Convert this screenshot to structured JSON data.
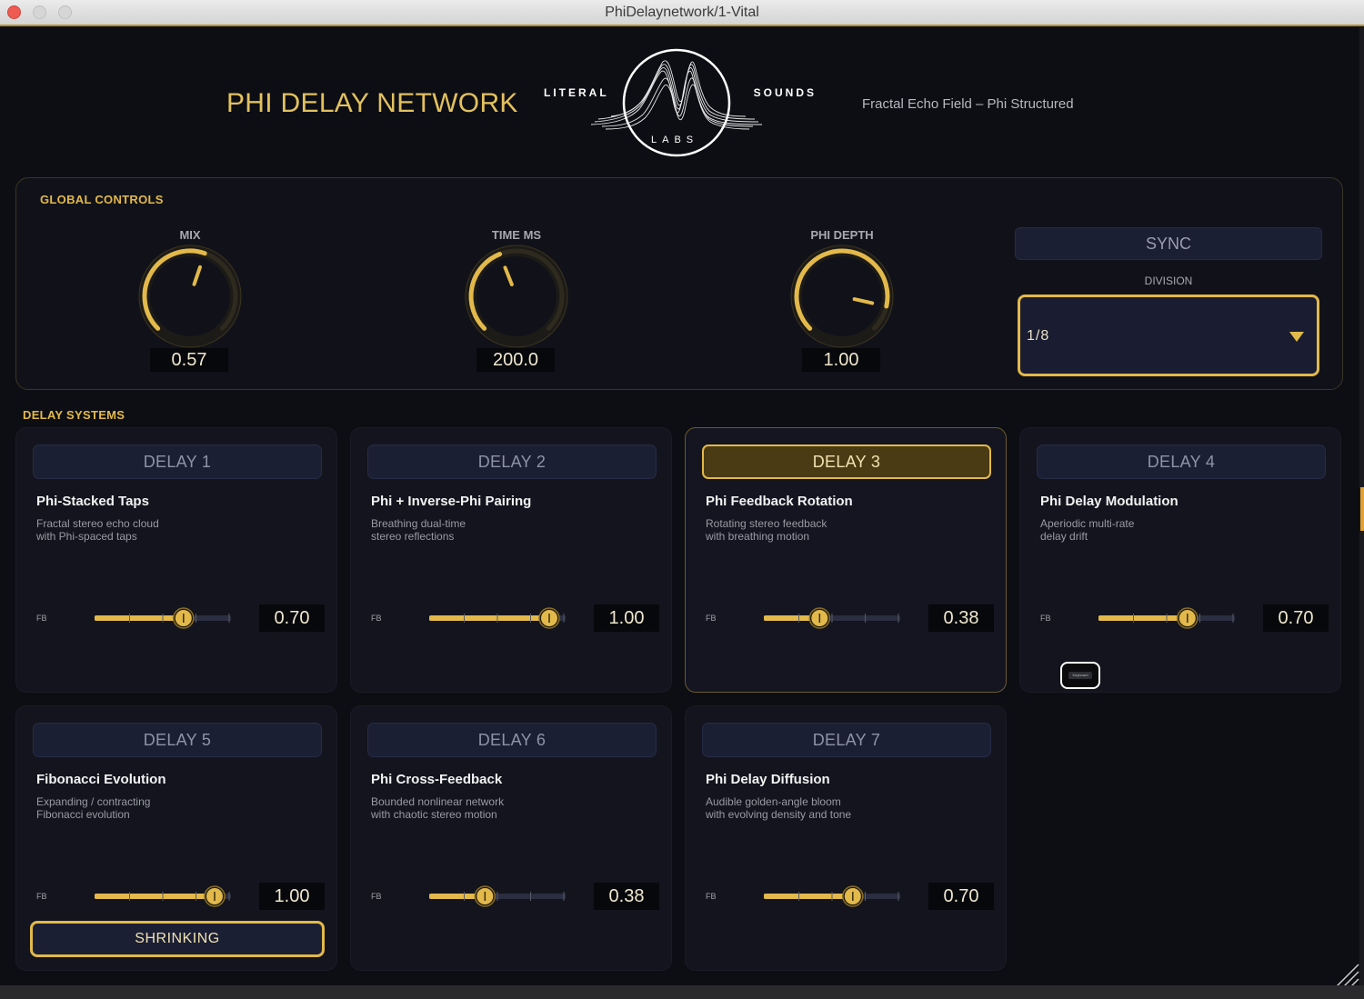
{
  "window": {
    "title": "PhiDelaynetwork/1-Vital"
  },
  "header": {
    "plugin_title": "PHI DELAY NETWORK",
    "logo_left": "LITERAL",
    "logo_right": "SOUNDS",
    "logo_bottom": "LABS",
    "subtitle": "Fractal Echo Field – Phi Structured"
  },
  "global": {
    "section_label": "GLOBAL CONTROLS",
    "knobs": [
      {
        "label": "MIX",
        "value": "0.57",
        "fraction": 0.57
      },
      {
        "label": "TIME MS",
        "value": "200.0",
        "fraction": 0.42
      },
      {
        "label": "PHI DEPTH",
        "value": "1.00",
        "fraction": 0.88
      }
    ],
    "sync_label": "SYNC",
    "division_label": "DIVISION",
    "division_value": "1/8"
  },
  "delays": {
    "section_label": "DELAY SYSTEMS",
    "fb_label": "FB",
    "items": [
      {
        "tab": "DELAY 1",
        "title": "Phi-Stacked Taps",
        "desc1": "Fractal stereo echo cloud",
        "desc2": "with Phi-spaced taps",
        "fb_value": "0.70",
        "fb_fraction": 0.7,
        "active": false
      },
      {
        "tab": "DELAY 2",
        "title": "Phi + Inverse-Phi Pairing",
        "desc1": "Breathing dual-time",
        "desc2": "stereo reflections",
        "fb_value": "1.00",
        "fb_fraction": 1.0,
        "active": false
      },
      {
        "tab": "DELAY 3",
        "title": "Phi Feedback Rotation",
        "desc1": "Rotating stereo feedback",
        "desc2": "with breathing motion",
        "fb_value": "0.38",
        "fb_fraction": 0.38,
        "active": true
      },
      {
        "tab": "DELAY 4",
        "title": "Phi Delay Modulation",
        "desc1": "Aperiodic multi-rate",
        "desc2": "delay drift",
        "fb_value": "0.70",
        "fb_fraction": 0.7,
        "active": false
      },
      {
        "tab": "DELAY 5",
        "title": "Fibonacci Evolution",
        "desc1": "Expanding / contracting",
        "desc2": "Fibonacci evolution",
        "fb_value": "1.00",
        "fb_fraction": 1.0,
        "active": false,
        "mode_button": "SHRINKING"
      },
      {
        "tab": "DELAY 6",
        "title": "Phi Cross-Feedback",
        "desc1": "Bounded nonlinear network",
        "desc2": "with chaotic stereo motion",
        "fb_value": "0.38",
        "fb_fraction": 0.38,
        "active": false
      },
      {
        "tab": "DELAY 7",
        "title": "Phi Delay Diffusion",
        "desc1": "Audible golden-angle bloom",
        "desc2": "with evolving density and tone",
        "fb_value": "0.70",
        "fb_fraction": 0.7,
        "active": false
      }
    ]
  },
  "keyboard_chip": "Keyboard",
  "colors": {
    "accent_gold": "#e2b94a",
    "background": "#0d0e13",
    "card": "#13141d",
    "tab": "#1b1f34"
  }
}
